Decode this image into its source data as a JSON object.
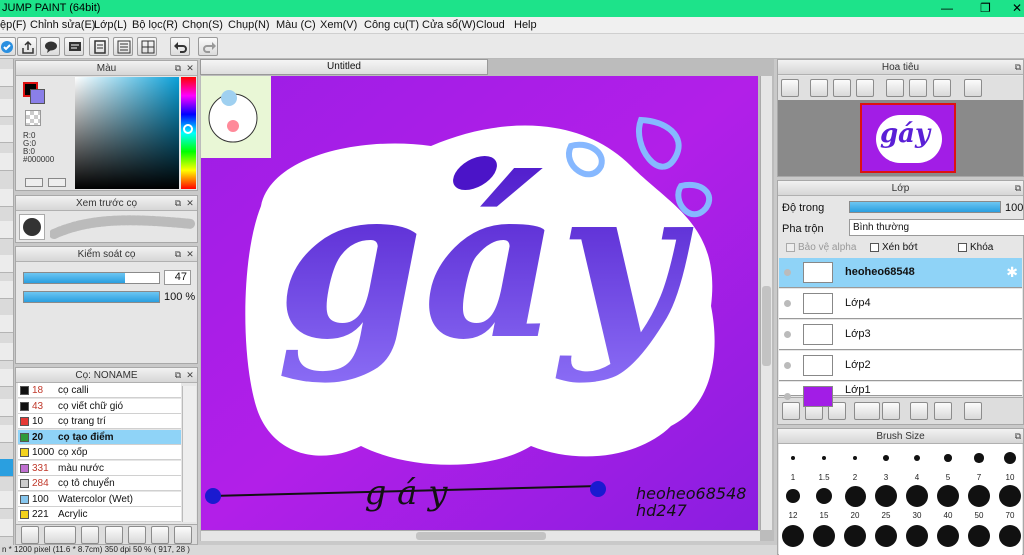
{
  "app": {
    "title": "JUMP PAINT (64bit)",
    "window_controls": [
      "—",
      "❐",
      "✕"
    ]
  },
  "menu": [
    "ệp(F)",
    "Chỉnh sửa(E)",
    "Lớp(L)",
    "Bộ lọc(R)",
    "Chọn(S)",
    "Chụp(N)",
    "Màu (C)",
    "Xem(V)",
    "Công cụ(T)",
    "Cửa sổ(W)",
    "Cloud",
    "Help"
  ],
  "color_panel": {
    "title": "Màu",
    "r": "R:0",
    "g": "G:0",
    "b": "B:0",
    "hex": "#000000"
  },
  "brush_preview": {
    "title": "Xem trước cọ"
  },
  "brush_control": {
    "title": "Kiểm soát cọ",
    "size_value": "47",
    "opacity_value": "100 %",
    "size_fill": 0.75,
    "opacity_fill": 1.0
  },
  "brush_list": {
    "title": "Cọ: NONAME",
    "items": [
      {
        "num": "18",
        "label": "cọ calli",
        "color": "#111111",
        "num_color": "#c0392b"
      },
      {
        "num": "43",
        "label": "cọ viết chữ gió",
        "color": "#111111",
        "num_color": "#c0392b"
      },
      {
        "num": "10",
        "label": "cọ trang trí",
        "color": "#e53935",
        "num_color": "#111111"
      },
      {
        "num": "20",
        "label": "cọ tạo điểm",
        "color": "#2e9a3a",
        "num_color": "#111111"
      },
      {
        "num": "1000",
        "label": "cọ xốp",
        "color": "#f4d21c",
        "num_color": "#111111"
      },
      {
        "num": "331",
        "label": "màu nước",
        "color": "#c070d0",
        "num_color": "#c0392b"
      },
      {
        "num": "284",
        "label": "cọ tô chuyển",
        "color": "#cccccc",
        "num_color": "#c0392b"
      },
      {
        "num": "100",
        "label": "Watercolor (Wet)",
        "color": "#86c6ee",
        "num_color": "#111111"
      },
      {
        "num": "221",
        "label": "Acrylic",
        "color": "#f4d21c",
        "num_color": "#111111"
      }
    ]
  },
  "canvas": {
    "tab_title": "Untitled",
    "art_text_main": "gáy",
    "art_text_bottom": "g á y",
    "signature_line1": "heoheo68548",
    "signature_line2": "hd247",
    "colors": {
      "background": "#b01de6",
      "outline": "#ffffff",
      "letters": "#5a1fd6",
      "accent": "#7fb4ff"
    }
  },
  "status_bar": "n * 1200 pixel  (11.6 * 8.7cm)  350 dpi  50 %  ( 917, 28 )",
  "navigator": {
    "title": "Hoa tiêu"
  },
  "layers": {
    "title": "Lớp",
    "opacity_label": "Độ trong",
    "opacity_value": "100 %",
    "blend_label": "Pha trộn",
    "blend_value": "Bình thường",
    "protect_alpha": "Bảo vệ alpha",
    "clipping": "Xén bớt",
    "lock": "Khóa",
    "items": [
      {
        "name": "heoheo68548",
        "selected": true
      },
      {
        "name": "Lớp4",
        "selected": false
      },
      {
        "name": "Lớp3",
        "selected": false
      },
      {
        "name": "Lớp2",
        "selected": false
      },
      {
        "name": "Lớp1",
        "selected": false
      }
    ]
  },
  "brush_size": {
    "title": "Brush Size",
    "sizes": [
      "1",
      "1.5",
      "2",
      "3",
      "4",
      "5",
      "7",
      "10",
      "12",
      "15",
      "20",
      "25",
      "30",
      "40",
      "50",
      "70"
    ]
  }
}
